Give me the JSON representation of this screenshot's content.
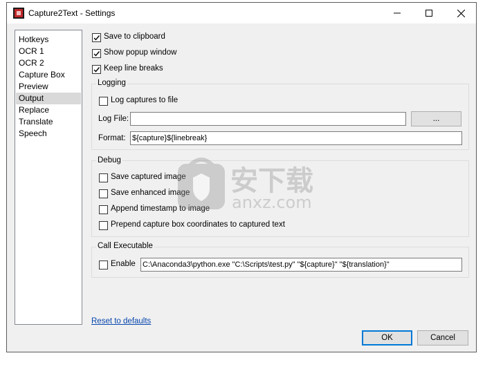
{
  "window": {
    "title": "Capture2Text - Settings"
  },
  "sidebar": {
    "items": [
      {
        "label": "Hotkeys",
        "selected": false
      },
      {
        "label": "OCR 1",
        "selected": false
      },
      {
        "label": "OCR 2",
        "selected": false
      },
      {
        "label": "Capture Box",
        "selected": false
      },
      {
        "label": "Preview",
        "selected": false
      },
      {
        "label": "Output",
        "selected": true
      },
      {
        "label": "Replace",
        "selected": false
      },
      {
        "label": "Translate",
        "selected": false
      },
      {
        "label": "Speech",
        "selected": false
      }
    ]
  },
  "output": {
    "save_to_clipboard": {
      "label": "Save to clipboard",
      "checked": true
    },
    "show_popup_window": {
      "label": "Show popup window",
      "checked": true
    },
    "keep_line_breaks": {
      "label": "Keep line breaks",
      "checked": true
    }
  },
  "logging": {
    "group_title": "Logging",
    "log_captures": {
      "label": "Log captures to file",
      "checked": false
    },
    "log_file_label": "Log File:",
    "log_file_value": "",
    "browse_label": "...",
    "format_label": "Format:",
    "format_value": "${capture}${linebreak}"
  },
  "debug": {
    "group_title": "Debug",
    "save_captured_image": {
      "label": "Save captured image",
      "checked": false
    },
    "save_enhanced_image": {
      "label": "Save enhanced image",
      "checked": false
    },
    "append_timestamp": {
      "label": "Append timestamp to image",
      "checked": false
    },
    "prepend_coordinates": {
      "label": "Prepend capture box coordinates to captured text",
      "checked": false
    }
  },
  "call_executable": {
    "group_title": "Call Executable",
    "enable": {
      "label": "Enable",
      "checked": false
    },
    "command_value": "C:\\Anaconda3\\python.exe \"C:\\Scripts\\test.py\" \"${capture}\" \"${translation}\""
  },
  "footer": {
    "reset_link": "Reset to defaults",
    "ok_label": "OK",
    "cancel_label": "Cancel"
  },
  "watermark": {
    "text": "安下载",
    "subtext": "anxz.com"
  },
  "colors": {
    "accent": "#0078d7",
    "link": "#0645ad",
    "selected_bg": "#d9d9d9"
  }
}
